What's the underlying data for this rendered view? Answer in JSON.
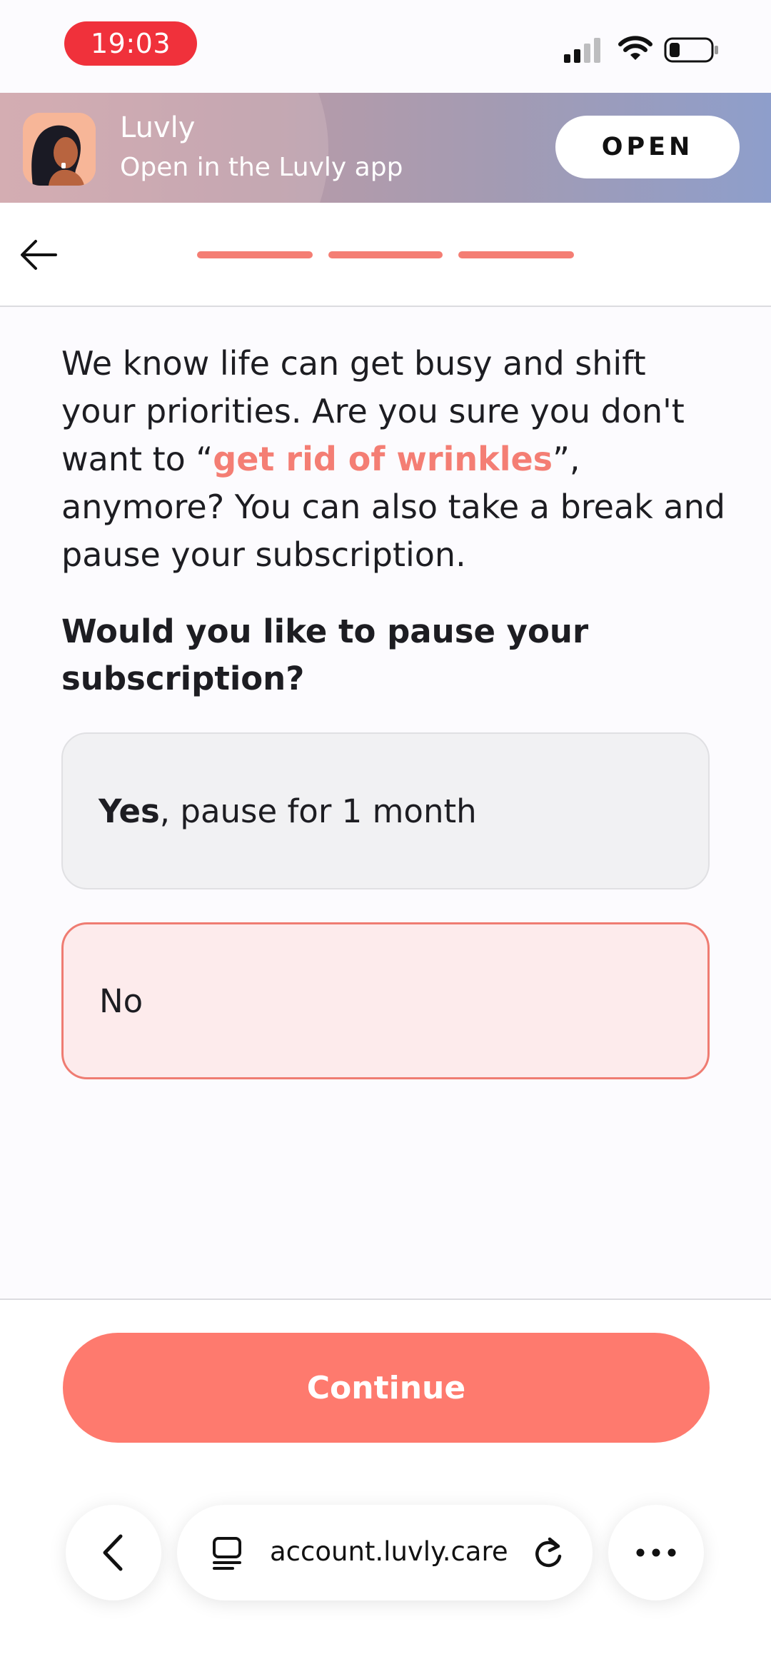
{
  "status_bar": {
    "time": "19:03"
  },
  "app_banner": {
    "title": "Luvly",
    "subtitle": "Open in the Luvly app",
    "open_label": "OPEN"
  },
  "progress": {
    "steps_total": 3,
    "steps_completed": 3,
    "color": "#f47e74"
  },
  "message": {
    "part1": "We know life can get busy and shift your priorities. Are you sure you don't want to “",
    "highlight": "get rid of wrinkles",
    "part2": "”, anymore? You can also take a break and pause your subscription."
  },
  "question": "Would you like to pause your subscription?",
  "options": [
    {
      "bold": "Yes",
      "rest": ", pause for 1 month",
      "selected": false
    },
    {
      "bold": "",
      "rest": "No",
      "selected": true
    }
  ],
  "continue_label": "Continue",
  "browser": {
    "url": "account.luvly.care"
  },
  "colors": {
    "accent": "#fe7a6e",
    "status_time_pill": "#f0313b",
    "selected_option_bg": "#fdebec"
  }
}
